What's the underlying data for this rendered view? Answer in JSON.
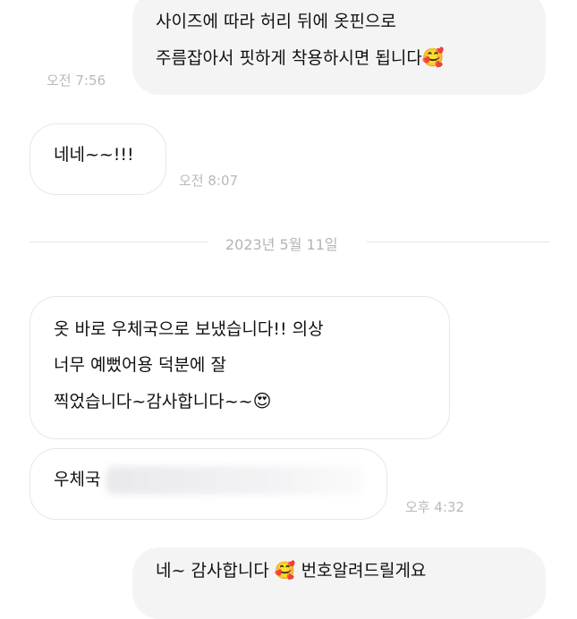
{
  "messages": [
    {
      "lines": [
        "사이즈에 따라 허리 뒤에 옷핀으로",
        "주름잡아서 핏하게 착용하시면 됩니다"
      ],
      "emoji": "🥰",
      "time": "오전 7:56"
    },
    {
      "lines": [
        "네네~~!!!"
      ],
      "time": "오전 8:07"
    },
    {
      "lines": [
        "옷 바로 우체국으로 보냈습니다!! 의상",
        "너무 예뻤어용 덕분에 잘",
        "찍었습니다~감사합니다~~"
      ],
      "emoji": "😍"
    },
    {
      "lines": [
        "우체국"
      ],
      "time": "오후 4:32"
    },
    {
      "lines": [
        "네~ 감사합니다 🥰 번호알려드릴게요"
      ]
    }
  ],
  "date_divider": "2023년 5월 11일"
}
